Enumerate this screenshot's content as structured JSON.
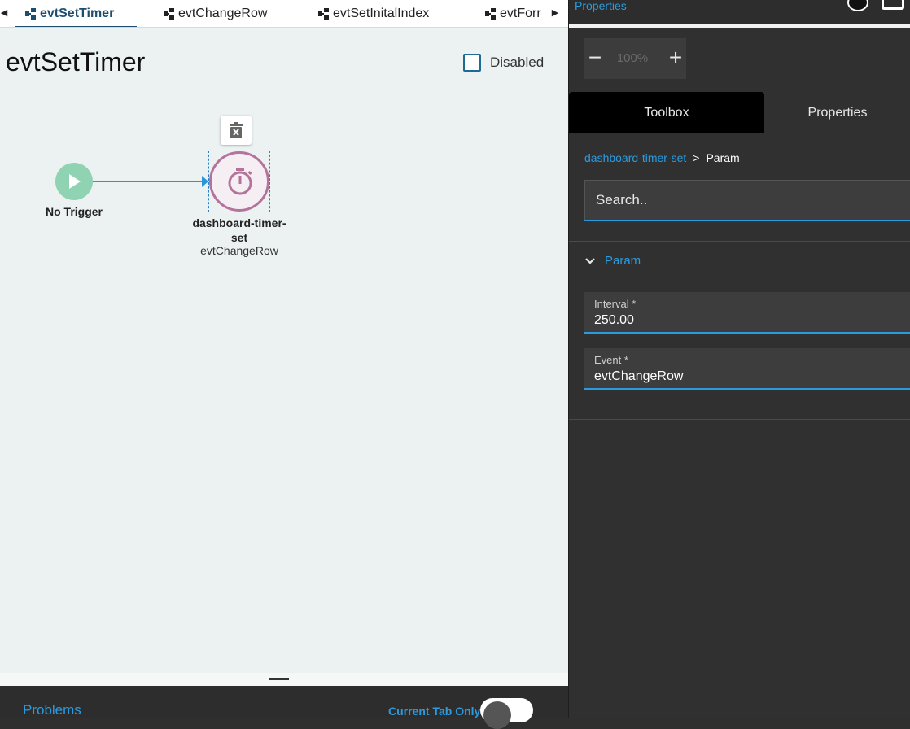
{
  "tabs": [
    {
      "label": "evtSetTimer",
      "active": true
    },
    {
      "label": "evtChangeRow",
      "active": false
    },
    {
      "label": "evtSetInitalIndex",
      "active": false
    },
    {
      "label": "evtForr",
      "active": false
    }
  ],
  "flow": {
    "title": "evtSetTimer",
    "disabled_label": "Disabled",
    "disabled_checked": false
  },
  "canvas": {
    "trigger_label": "No Trigger",
    "node_label": "dashboard-timer-set",
    "node_sublabel": "evtChangeRow"
  },
  "bottom": {
    "problems_label": "Problems",
    "current_tab_label": "Current Tab Only",
    "current_tab_on": false
  },
  "right_panel": {
    "header_title": "Properties",
    "zoom": {
      "value": "100%",
      "minus": "−",
      "plus": "+"
    },
    "tabs": [
      {
        "label": "Toolbox",
        "active": true
      },
      {
        "label": "Properties",
        "active": false
      }
    ],
    "breadcrumb": {
      "link": "dashboard-timer-set",
      "separator": ">",
      "current": "Param"
    },
    "search": {
      "placeholder": "Search..",
      "value": ""
    },
    "section": {
      "label": "Param",
      "expanded": true
    },
    "fields": {
      "interval": {
        "label": "Interval *",
        "value": "250.00"
      },
      "event": {
        "label": "Event *",
        "value": "evtChangeRow"
      }
    }
  },
  "colors": {
    "accent": "#2b9be0",
    "tab_active": "#1d4e70",
    "trigger_node": "#8fd3b3",
    "timer_node": "#b4739a",
    "connector": "#2b95d6"
  },
  "icons": [
    "flow-icon",
    "play-icon",
    "trash-icon",
    "stopwatch-icon",
    "chevron-down-icon",
    "user-icon",
    "screen-icon"
  ]
}
